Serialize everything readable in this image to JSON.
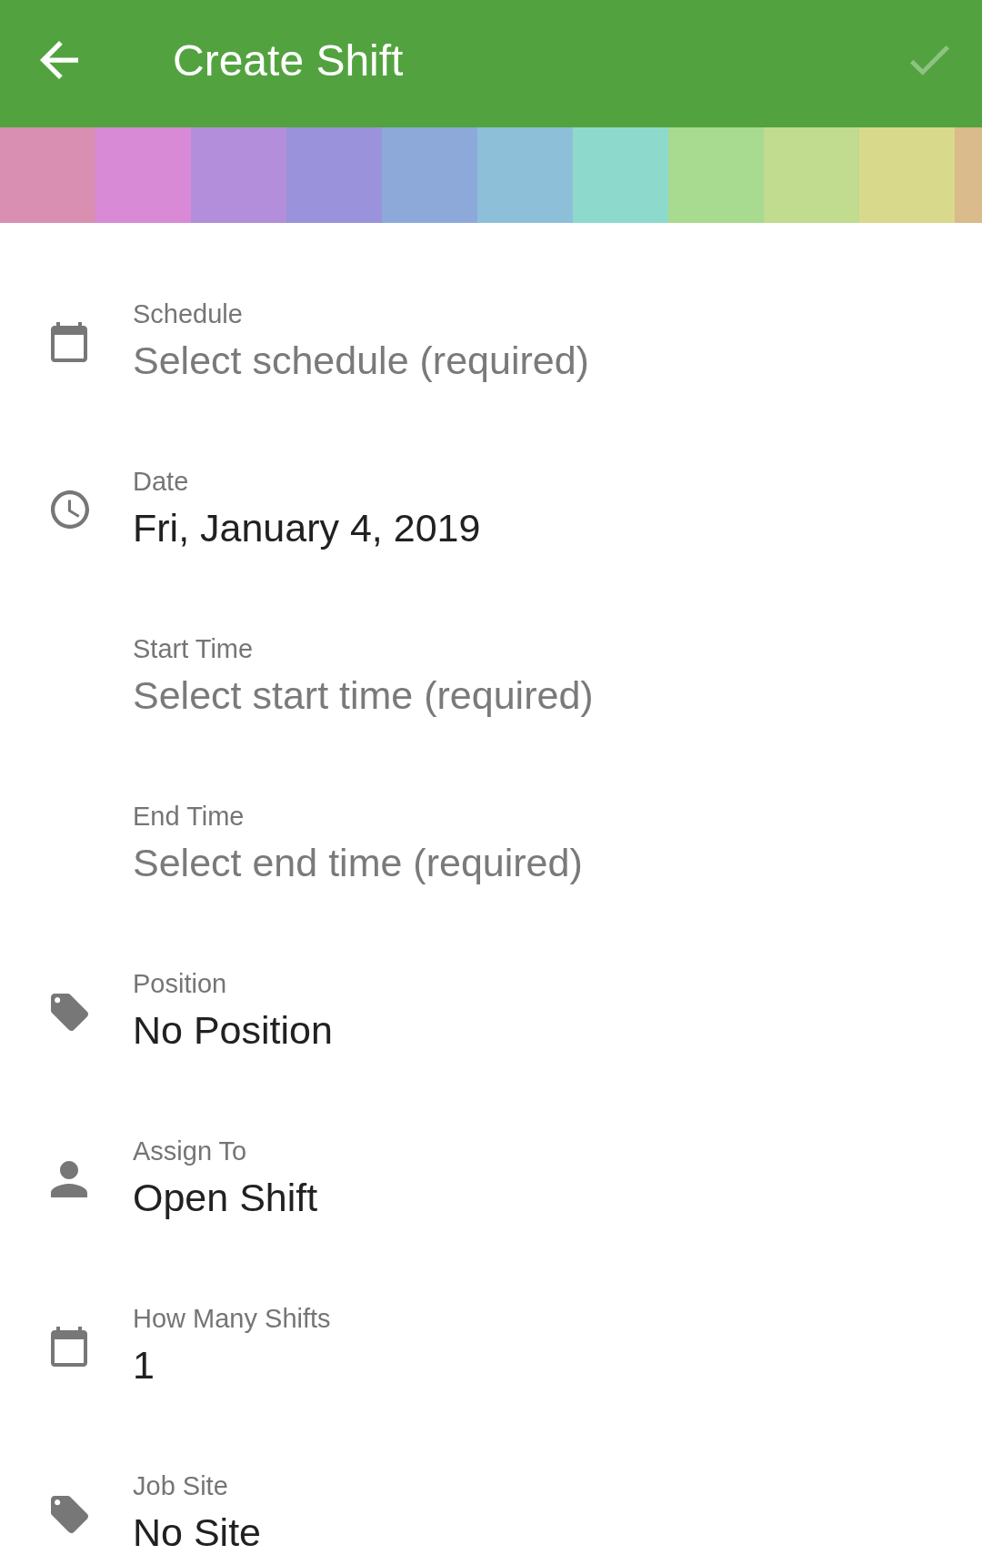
{
  "app_bar": {
    "title": "Create Shift",
    "confirm": {
      "disabled": true
    }
  },
  "palette": [
    {
      "color": "#d98fb2"
    },
    {
      "color": "#d98ad7"
    },
    {
      "color": "#b28edb"
    },
    {
      "color": "#9a92db"
    },
    {
      "color": "#8ca9da"
    },
    {
      "color": "#8dbfd9"
    },
    {
      "color": "#8ddacd"
    },
    {
      "color": "#a8da8f"
    },
    {
      "color": "#c1db8f"
    },
    {
      "color": "#d9d98c"
    },
    {
      "color": "#d9bb8c"
    }
  ],
  "fields": [
    {
      "label": "Schedule",
      "placeholder": "Select schedule (required)"
    },
    {
      "label": "Date",
      "value": "Fri, January 4, 2019"
    },
    {
      "label": "Start Time",
      "placeholder": "Select start time (required)"
    },
    {
      "label": "End Time",
      "placeholder": "Select end time (required)"
    },
    {
      "label": "Position",
      "value": "No Position"
    },
    {
      "label": "Assign To",
      "value": "Open Shift"
    },
    {
      "label": "How Many Shifts",
      "value": "1"
    },
    {
      "label": "Job Site",
      "value": "No Site"
    }
  ]
}
